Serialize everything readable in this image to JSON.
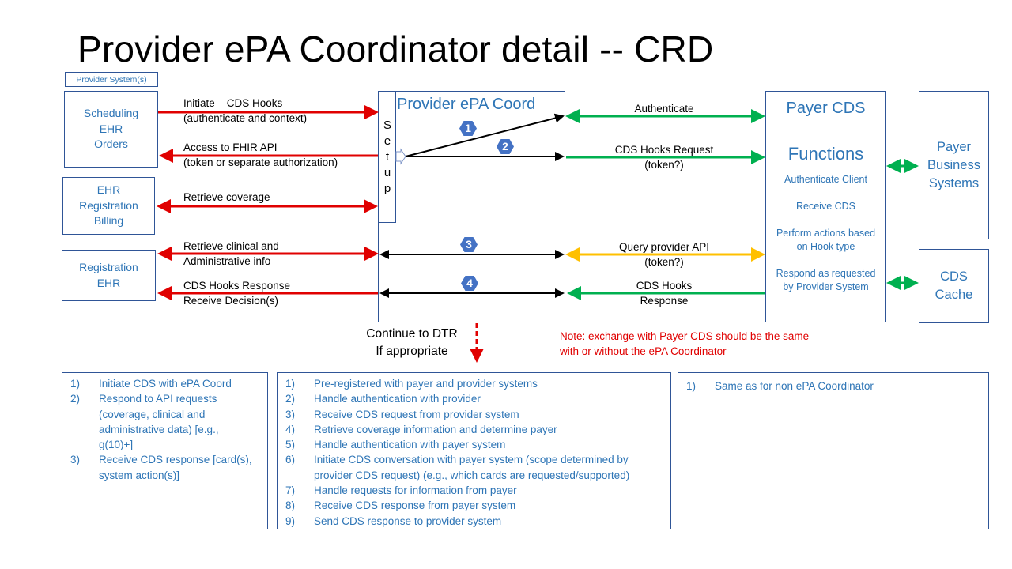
{
  "title": "Provider ePA Coordinator detail -- CRD",
  "provider_systems_label": "Provider System(s)",
  "provider_boxes": [
    {
      "lines": [
        "Scheduling",
        "EHR",
        "Orders"
      ]
    },
    {
      "lines": [
        "EHR",
        "Registration",
        "Billing"
      ]
    },
    {
      "lines": [
        "Registration",
        "EHR"
      ]
    }
  ],
  "coordinator": {
    "title": "Provider ePA Coord",
    "setup_letters": [
      "S",
      "e",
      "t",
      "u",
      "p"
    ],
    "badges": [
      "1",
      "2",
      "3",
      "4"
    ]
  },
  "left_flows": [
    {
      "lines": [
        "Initiate – CDS Hooks",
        "(authenticate and context)"
      ],
      "color": "#e00000",
      "direction": "right"
    },
    {
      "lines": [
        "Access to FHIR API",
        "(token or separate authorization)"
      ],
      "color": "#e00000",
      "direction": "left"
    },
    {
      "lines": [
        "Retrieve coverage"
      ],
      "color": "#e00000",
      "direction": "both"
    },
    {
      "lines": [
        "Retrieve clinical and",
        "Administrative info"
      ],
      "color": "#e00000",
      "direction": "both"
    },
    {
      "lines": [
        "CDS Hooks  Response",
        "Receive Decision(s)"
      ],
      "color": "#e00000",
      "direction": "left"
    }
  ],
  "right_flows": [
    {
      "lines": [
        "Authenticate"
      ],
      "color": "#00b050",
      "direction": "both"
    },
    {
      "lines": [
        "CDS Hooks  Request",
        "(token?)"
      ],
      "color": "#00b050",
      "direction": "right"
    },
    {
      "lines": [
        "Query provider API",
        "(token?)"
      ],
      "color": "#ffc000",
      "direction": "both"
    },
    {
      "lines": [
        "CDS Hooks",
        "Response"
      ],
      "color": "#00b050",
      "direction": "left"
    }
  ],
  "payer_cds": {
    "title_lines": [
      "Payer CDS",
      "Functions"
    ],
    "functions": [
      [
        "Authenticate  Client"
      ],
      [
        "Receive CDS"
      ],
      [
        "Perform actions based",
        "on Hook type"
      ],
      [
        "Respond as requested",
        "by Provider System"
      ]
    ]
  },
  "payer_business": {
    "lines": [
      "Payer",
      "Business",
      "Systems"
    ]
  },
  "cds_cache": {
    "lines": [
      "CDS",
      "Cache"
    ]
  },
  "continue_dtr": [
    "Continue to DTR",
    "If appropriate"
  ],
  "note": [
    "Note:  exchange with Payer CDS should be the same",
    "with or without  the ePA Coordinator"
  ],
  "colors": {
    "box_border": "#2f5597",
    "text_blue": "#2e75b6",
    "red_arrow": "#e00000",
    "green_arrow": "#00b050",
    "yellow_arrow": "#ffc000",
    "badge": "#4472c4"
  },
  "lists": {
    "provider": [
      {
        "num": "1)",
        "lines": [
          "Initiate CDS with ePA Coord"
        ]
      },
      {
        "num": "2)",
        "lines": [
          "Respond to API requests",
          "(coverage, clinical and",
          "administrative data) [e.g.,",
          "g(10)+]"
        ]
      },
      {
        "num": "3)",
        "lines": [
          "Receive CDS response [card(s),",
          "system action(s)]"
        ]
      }
    ],
    "coordinator": [
      {
        "num": "1)",
        "lines": [
          "Pre-registered with payer and provider systems"
        ]
      },
      {
        "num": "2)",
        "lines": [
          "Handle authentication with provider"
        ]
      },
      {
        "num": "3)",
        "lines": [
          "Receive CDS request from  provider system"
        ]
      },
      {
        "num": "4)",
        "lines": [
          "Retrieve coverage information  and determine payer"
        ]
      },
      {
        "num": "5)",
        "lines": [
          "Handle authentication with payer system"
        ]
      },
      {
        "num": "6)",
        "lines": [
          "Initiate CDS conversation with payer system (scope determined  by",
          "provider  CDS request) (e.g., which cards are requested/supported)"
        ]
      },
      {
        "num": "7)",
        "lines": [
          "Handle requests for information  from payer"
        ]
      },
      {
        "num": "8)",
        "lines": [
          "Receive CDS response from payer system"
        ]
      },
      {
        "num": "9)",
        "lines": [
          "Send CDS response to provider system"
        ]
      }
    ],
    "payer": [
      {
        "num": "1)",
        "lines": [
          "Same as for non  ePA Coordinator"
        ]
      }
    ]
  }
}
